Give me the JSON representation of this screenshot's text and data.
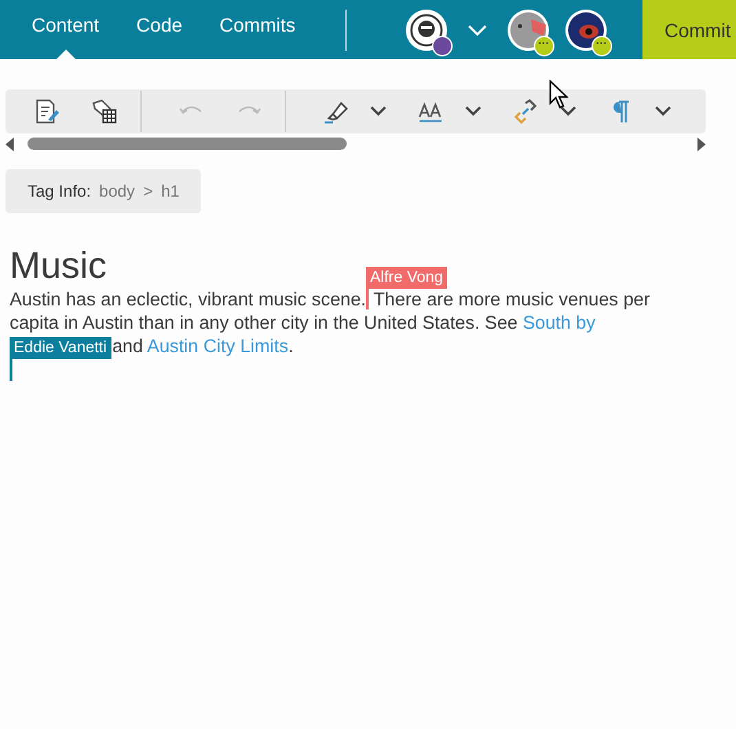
{
  "tabs": [
    {
      "label": "Content",
      "selected": true
    },
    {
      "label": "Code",
      "selected": false
    },
    {
      "label": "Commits",
      "selected": false
    }
  ],
  "collaborators": [
    {
      "kind": "self",
      "color": "#6b4a9e"
    },
    {
      "kind": "menu"
    },
    {
      "kind": "other",
      "color": "#b5cc18",
      "badge": "···"
    },
    {
      "kind": "other",
      "color": "#b5cc18",
      "badge": "···"
    }
  ],
  "commit_button": "Commit",
  "toolbar": [
    {
      "kind": "edit",
      "disabled": false
    },
    {
      "kind": "tags",
      "disabled": false
    },
    {
      "kind": "sep"
    },
    {
      "kind": "undo",
      "disabled": true
    },
    {
      "kind": "redo",
      "disabled": true
    },
    {
      "kind": "sep"
    },
    {
      "kind": "highlight",
      "disabled": false,
      "dropdown": true
    },
    {
      "kind": "textsize",
      "disabled": false,
      "dropdown": true
    },
    {
      "kind": "link",
      "disabled": false,
      "dropdown": true
    },
    {
      "kind": "pilcrow",
      "disabled": false,
      "dropdown": true
    }
  ],
  "tag_info": {
    "label": "Tag Info:",
    "path": [
      "body",
      "h1"
    ],
    "separator": ">"
  },
  "document": {
    "heading": "Music",
    "paragraph": [
      {
        "kind": "text",
        "text": "Austin has an eclectic, vibrant music scene."
      },
      {
        "kind": "cursor",
        "user": "Alfre Vong",
        "color": "#f26b6b"
      },
      {
        "kind": "text",
        "text": " There are more music venues per capita in Austin than in any other city in the United States. See "
      },
      {
        "kind": "link",
        "text": "South by"
      },
      {
        "kind": "break"
      },
      {
        "kind": "text",
        "text": "and "
      },
      {
        "kind": "link",
        "text": "Austin City Limits"
      },
      {
        "kind": "text",
        "text": "."
      }
    ],
    "cursor_below": {
      "user": "Eddie Vanetti",
      "color": "#0d7f9e"
    }
  }
}
